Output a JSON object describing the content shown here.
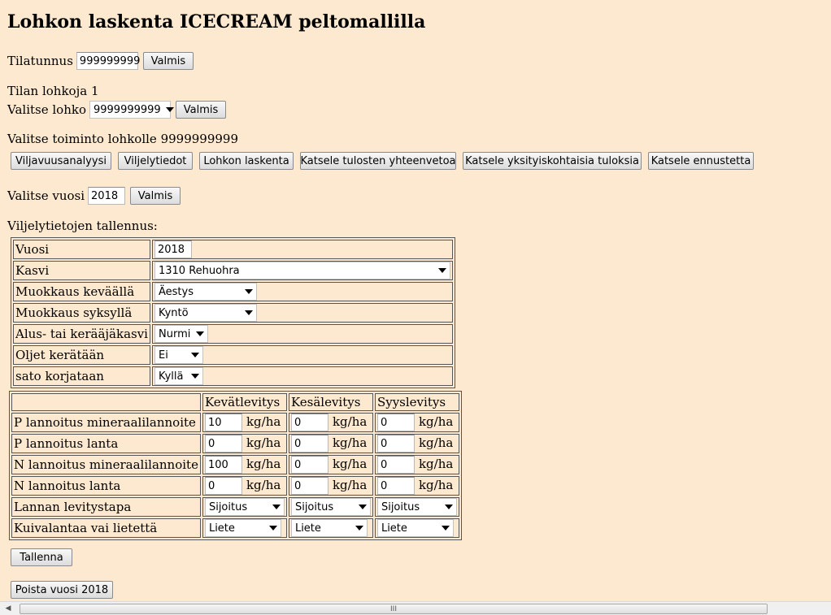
{
  "title": "Lohkon laskenta ICECREAM peltomallilla",
  "farm": {
    "label": "Tilatunnus",
    "value": "999999999",
    "button": "Valmis"
  },
  "plots": {
    "count_text": "Tilan lohkoja 1",
    "select_label": "Valitse lohko",
    "selected": "9999999999",
    "button": "Valmis"
  },
  "actions": {
    "heading": "Valitse toiminto lohkolle 9999999999",
    "buttons": [
      "Viljavuusanalyysi",
      "Viljelytiedot",
      "Lohkon laskenta",
      "Katsele tulosten yhteenvetoa",
      "Katsele yksityiskohtaisia tuloksia",
      "Katsele ennustetta"
    ]
  },
  "year": {
    "label": "Valitse vuosi",
    "value": "2018",
    "button": "Valmis"
  },
  "save_section": {
    "heading": "Viljelytietojen tallennus:",
    "rows": {
      "vuosi": {
        "label": "Vuosi",
        "value": "2018"
      },
      "kasvi": {
        "label": "Kasvi",
        "value": "1310 Rehuohra"
      },
      "spring_tillage": {
        "label": "Muokkaus keväällä",
        "value": "Äestys"
      },
      "autumn_tillage": {
        "label": "Muokkaus syksyllä",
        "value": "Kyntö"
      },
      "cover_crop": {
        "label": "Alus- tai kerääjäkasvi",
        "value": "Nurmi"
      },
      "straw": {
        "label": "Oljet kerätään",
        "value": "Ei"
      },
      "harvest": {
        "label": "sato korjataan",
        "value": "Kyllä"
      }
    },
    "fert": {
      "headers": [
        "Kevätlevitys",
        "Kesälevitys",
        "Syyslevitys"
      ],
      "unit": "kg/ha",
      "rows": [
        {
          "label": "P lannoitus mineraalilannoite",
          "values": [
            "10",
            "0",
            "0"
          ]
        },
        {
          "label": "P lannoitus lanta",
          "values": [
            "0",
            "0",
            "0"
          ]
        },
        {
          "label": "N lannoitus mineraalilannoite",
          "values": [
            "100",
            "0",
            "0"
          ]
        },
        {
          "label": "N lannoitus lanta",
          "values": [
            "0",
            "0",
            "0"
          ]
        }
      ],
      "method": {
        "label": "Lannan levitystapa",
        "values": [
          "Sijoitus",
          "Sijoitus",
          "Sijoitus"
        ]
      },
      "type": {
        "label": "Kuivalantaa vai lietettä",
        "values": [
          "Liete",
          "Liete",
          "Liete"
        ]
      }
    },
    "save_button": "Tallenna",
    "delete_button": "Poista vuosi 2018"
  },
  "scrollbar": {
    "grip": "III",
    "left_arrow": "◀"
  }
}
